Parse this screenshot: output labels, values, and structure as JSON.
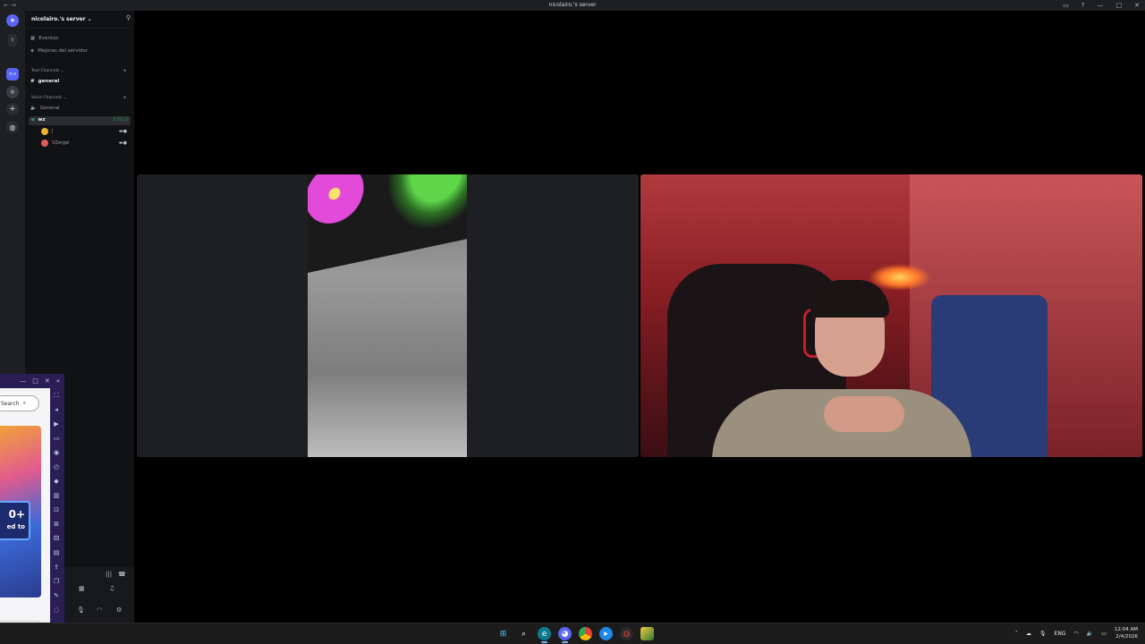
{
  "window": {
    "title": "nicolairo.'s server",
    "back_glyph": "←",
    "forward_glyph": "→"
  },
  "server": {
    "name": "nicolairo.'s server",
    "menu_items": [
      "Eventos",
      "Mejoras del servidor"
    ],
    "text_category": "Text Channels",
    "text_channels": [
      "general"
    ],
    "voice_category": "Voice Channels",
    "voice_channels": [
      "General",
      "wz"
    ],
    "active_voice_timer": "2:55:27",
    "voice_members": [
      "J",
      "VZergel"
    ]
  },
  "rail": {
    "servers": [
      "discord-home",
      "server-1",
      "server-nicolairo",
      "server-3",
      "add-server",
      "discover"
    ]
  },
  "overlay": {
    "search_label": "Search",
    "promo_number": "0+",
    "promo_text": "ed to"
  },
  "taskbar": {
    "apps": [
      "start",
      "search",
      "edge",
      "discord",
      "chrome",
      "app-blue",
      "app-red",
      "app-stack"
    ],
    "lang": "ENG",
    "time": "12:04 AM",
    "date": "2/4/2026"
  },
  "colors": {
    "sidebar_bg": "#111214",
    "rail_bg": "#1e1f22",
    "tile_bg": "#1e1f22",
    "voice_green": "#23a55a",
    "overlay_purple": "#2a1f55"
  }
}
